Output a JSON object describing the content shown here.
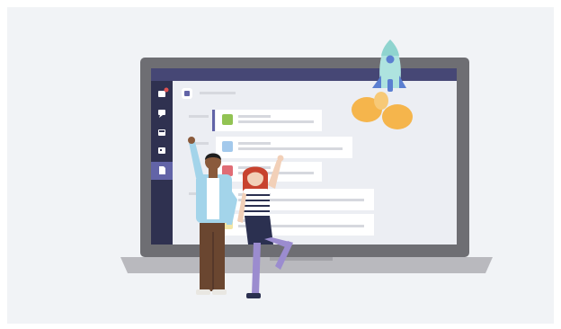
{
  "illustration": {
    "subject": "laptop-with-chat-app-and-people",
    "colors": {
      "background": "#f1f3f6",
      "laptop_frame": "#6e6e73",
      "laptop_base": "#b9b9be",
      "screen_bg": "#eceef3",
      "app_header": "#464775",
      "app_rail": "#2f3150",
      "rail_active": "#6264a7",
      "rocket_body": "#aee3df",
      "rocket_fin": "#5b7fd1",
      "rocket_flame": "#f5b54c",
      "card": "#ffffff",
      "avatar_green": "#92c353",
      "avatar_blue": "#a3c9ec",
      "avatar_red": "#e06c75",
      "avatar_yellow": "#f2e6a6"
    },
    "icons": [
      "activity-icon",
      "chat-icon",
      "teams-icon",
      "calendar-icon",
      "files-icon",
      "rocket-icon"
    ]
  }
}
